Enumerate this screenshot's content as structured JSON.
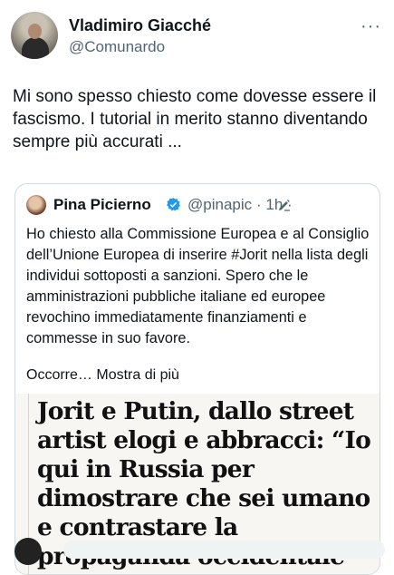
{
  "author": {
    "name": "Vladimiro Giacché",
    "handle": "@Comunardo",
    "more_icon": "···"
  },
  "tweet": {
    "text": "Mi sono spesso chiesto come dovesse essere il fascismo. I tutorial in merito stanno diventando sempre più accurati ..."
  },
  "quoted": {
    "name": "Pina Picierno",
    "handle": "@pinapic",
    "time": "· 1h ·",
    "text": "Ho chiesto alla Commissione Europea e al Consiglio dell’Unione  Europea di inserire #Jorit nella lista degli individui sottoposti a sanzioni. Spero che le amministrazioni pubbliche italiane ed europee revochino immediatamente finanziamenti e commesse in suo favore.",
    "truncated": "Occorre…",
    "show_more": "Mostra di più",
    "verified_color": "#1d9bf0",
    "headline": "Jorit e Putin, dallo street artist elogi e abbracci: “Io qui in Russia per dimostrare che sei umano e contrastare la propaganda occidentale”"
  }
}
